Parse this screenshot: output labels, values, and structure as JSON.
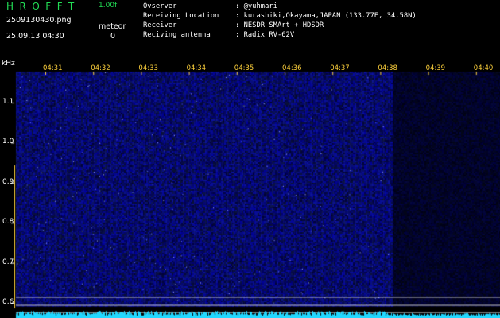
{
  "header": {
    "app_title": "HROFFT",
    "version": "1.00f",
    "filename": "2509130430.png",
    "datetime": "25.09.13 04:30",
    "meteor_label": "meteor",
    "meteor_count": "0",
    "info": [
      {
        "label": "Ovserver",
        "value": ": @yuhmari"
      },
      {
        "label": "Receiving Location",
        "value": ": kurashiki,Okayama,JAPAN (133.77E, 34.58N)"
      },
      {
        "label": "Receiver",
        "value": ": NESDR SMArt + HDSDR"
      },
      {
        "label": "Reciving antenna",
        "value": ": Radix RV-62V"
      }
    ]
  },
  "axes": {
    "y_unit": "kHz",
    "y_ticks": [
      "1.1",
      "1.0",
      "0.9",
      "0.8",
      "0.7",
      "0.6"
    ],
    "y_values": [
      1.1,
      1.0,
      0.9,
      0.8,
      0.7,
      0.6
    ],
    "x_ticks": [
      "04:31",
      "04:32",
      "04:33",
      "04:34",
      "04:35",
      "04:36",
      "04:37",
      "04:38",
      "04:39",
      "04:40"
    ]
  },
  "colors": {
    "title": "#22dd55",
    "version": "#22dd55",
    "tick_label": "#ffd23c",
    "spectrogram": "#141a8a",
    "spectrogram_dark": "#060830",
    "noise_trace": "#22d8ff"
  },
  "spectrogram": {
    "data_end_time": "04:38",
    "reference_lines_khz": [
      0.615,
      0.595,
      0.577
    ]
  }
}
